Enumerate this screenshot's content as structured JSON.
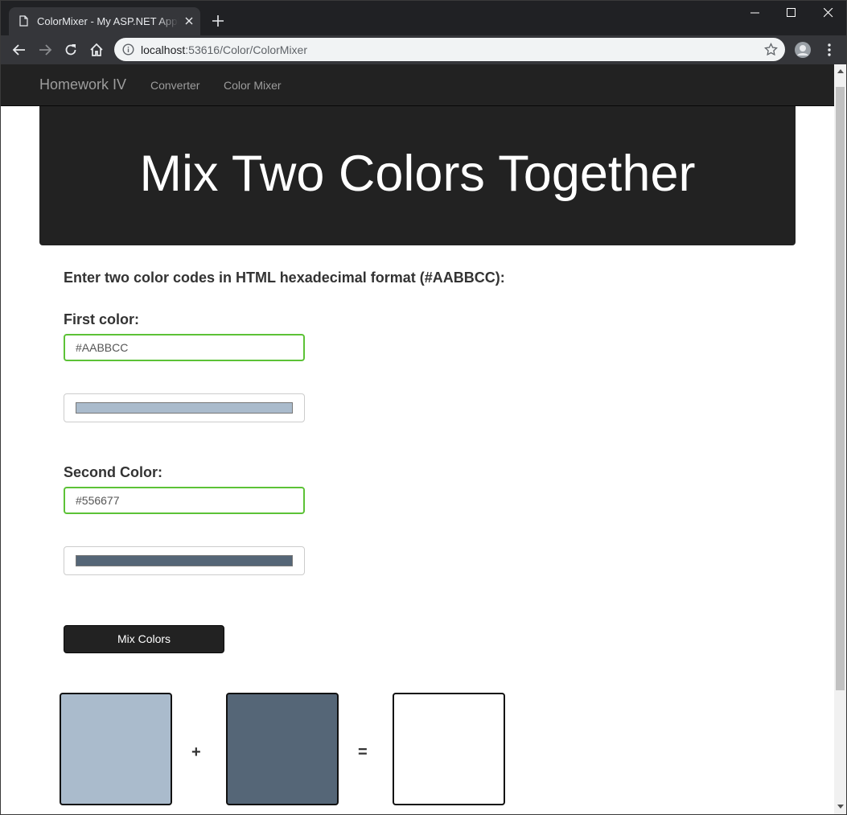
{
  "browser": {
    "tab_title": "ColorMixer - My ASP.NET Application",
    "url_host": "localhost",
    "url_path": ":53616/Color/ColorMixer"
  },
  "navbar": {
    "brand": "Homework IV",
    "links": [
      {
        "label": "Converter"
      },
      {
        "label": "Color Mixer"
      }
    ]
  },
  "jumbotron": {
    "title": "Mix Two Colors Together"
  },
  "form": {
    "instructions": "Enter two color codes in HTML hexadecimal format (#AABBCC):",
    "first": {
      "label": "First color:",
      "value": "#AABBCC",
      "swatch_color": "#AABBCC"
    },
    "second": {
      "label": "Second Color:",
      "value": "#556677",
      "swatch_color": "#556677"
    },
    "mix_button": "Mix Colors"
  },
  "result": {
    "first_color": "#AABBCC",
    "second_color": "#556677",
    "mixed_color": "#FFFFFF",
    "plus": "+",
    "equals": "="
  },
  "theme": {
    "navbar_bg": "#222222",
    "valid_border": "#5cc236"
  }
}
